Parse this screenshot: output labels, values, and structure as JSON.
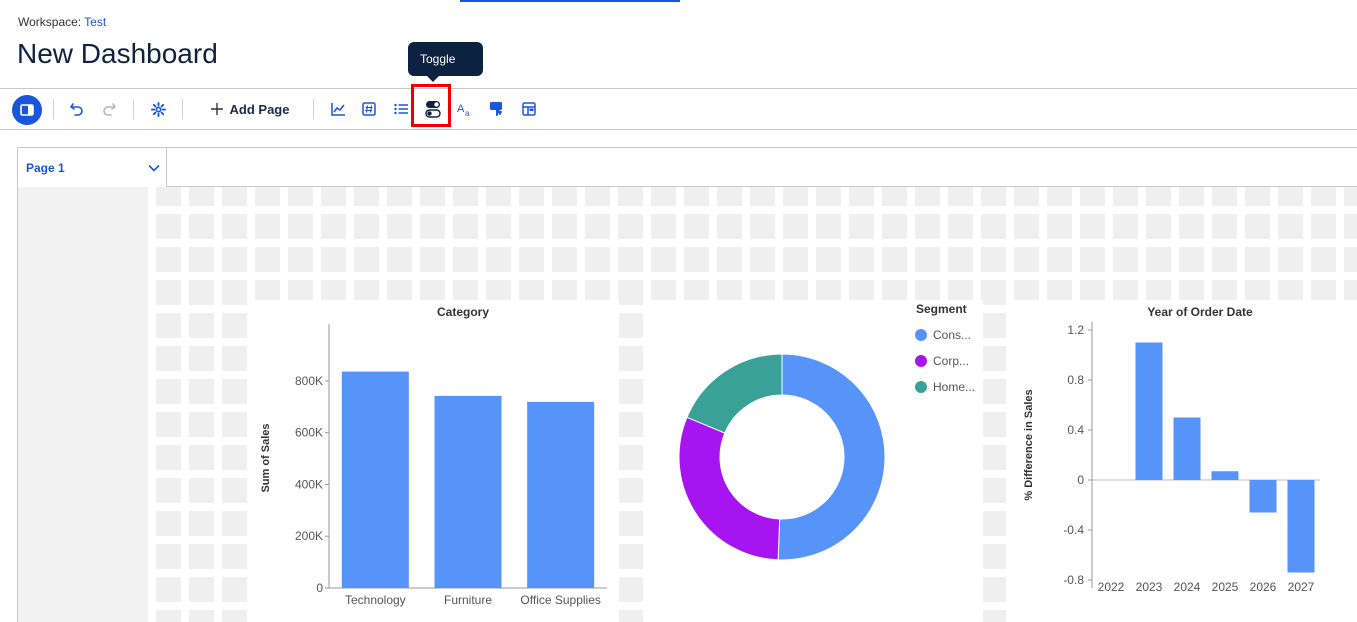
{
  "workspace": {
    "label": "Workspace:",
    "name": "Test"
  },
  "page_title": "New Dashboard",
  "tooltip": "Toggle",
  "toolbar": {
    "add_page_label": "Add Page"
  },
  "page_tab": {
    "label": "Page 1"
  },
  "colors": {
    "accent": "#1a56db",
    "bar": "#5794f9",
    "consumer": "#5794f9",
    "corporate": "#a615f0",
    "home": "#39a197",
    "highlight": "#e00000"
  },
  "chart_data": [
    {
      "type": "bar",
      "title": "Category",
      "ylabel": "Sum of Sales",
      "categories": [
        "Technology",
        "Furniture",
        "Office Supplies"
      ],
      "values": [
        836000,
        742000,
        719000
      ],
      "ylim": [
        0,
        900000
      ],
      "yticks": [
        0,
        200000,
        400000,
        600000,
        800000
      ],
      "ytick_labels": [
        "0",
        "200K",
        "400K",
        "600K",
        "800K"
      ]
    },
    {
      "type": "pie",
      "style": "donut",
      "title": "Segment",
      "labels": [
        "Cons...",
        "Corp...",
        "Home..."
      ],
      "values": [
        50.6,
        30.7,
        18.7
      ]
    },
    {
      "type": "bar",
      "title": "Year of Order Date",
      "ylabel": "% Difference in Sales",
      "categories": [
        "2022",
        "2023",
        "2024",
        "2025",
        "2026",
        "2027"
      ],
      "values": [
        null,
        1.1,
        0.5,
        0.07,
        -0.26,
        -0.74
      ],
      "ylim": [
        -0.8,
        1.2
      ],
      "yticks": [
        -0.8,
        -0.4,
        0,
        0.4,
        0.8,
        1.2
      ],
      "ytick_labels": [
        "-0.8",
        "-0.4",
        "0",
        "0.4",
        "0.8",
        "1.2"
      ]
    }
  ]
}
